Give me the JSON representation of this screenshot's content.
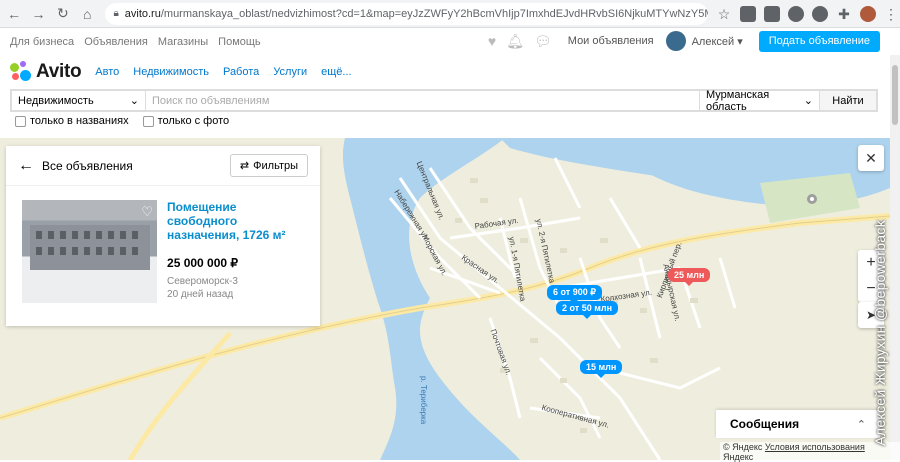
{
  "browser": {
    "url_host": "avito.ru",
    "url_path": "/murmanskaya_oblast/nedvizhimost?cd=1&map=eyJzZWFyY2hBcmVhIjp7ImxhdEJvdHRvbSI6NjkuMTYwNzY5MTYzOTM4MzEsImxhdFRvcCI..."
  },
  "top_menu": {
    "items": [
      "Для бизнеса",
      "Объявления",
      "Магазины",
      "Помощь"
    ],
    "my_ads": "Мои объявления",
    "user_name": "Алексей",
    "post_button": "Подать объявление"
  },
  "logo": {
    "text": "Avito",
    "colors": {
      "green": "#97cf26",
      "blue": "#0af",
      "purple": "#a169f7",
      "red": "#ff6163"
    }
  },
  "categories": [
    "Авто",
    "Недвижимость",
    "Работа",
    "Услуги",
    "ещё..."
  ],
  "search": {
    "category": "Недвижимость",
    "placeholder": "Поиск по объявлениям",
    "region": "Мурманская область",
    "button": "Найти"
  },
  "filters": {
    "names_only": "только в названиях",
    "with_photo": "только с фото"
  },
  "panel": {
    "back_label": "Все объявления",
    "filter_button": "Фильтры"
  },
  "listing": {
    "title": "Помещение свободного назначения, 1726 м²",
    "price": "25 000 000 ₽",
    "location": "Североморск-3",
    "date": "20 дней назад"
  },
  "map": {
    "pins": [
      {
        "label": "6 от 900 ₽",
        "color": "blue"
      },
      {
        "label": "2 от 50 млн",
        "color": "blue"
      },
      {
        "label": "15 млн",
        "color": "blue"
      },
      {
        "label": "25 млн",
        "color": "red"
      }
    ],
    "streets": {
      "s1": "Центральная ул.",
      "s2": "Набережная ул.",
      "s3": "Рабочая ул.",
      "s4": "ул. 2-я Пятилетка",
      "s5": "ул. 1-я Пятилетка",
      "s6": "Морская ул.",
      "s7": "Красная ул.",
      "s8": "Колхозная ул.",
      "s9": "Почтовая ул.",
      "s10": "Кооперативная ул.",
      "s11": "Анадырская ул.",
      "s12": "Кирпичный пер."
    },
    "river": "р. Териберка",
    "copyright": "© Яндекс",
    "terms": "Условия использования",
    "brand": "Яндекс"
  },
  "messages": {
    "title": "Сообщения"
  },
  "watermark": "Алексей Жирухин @bepowerback"
}
